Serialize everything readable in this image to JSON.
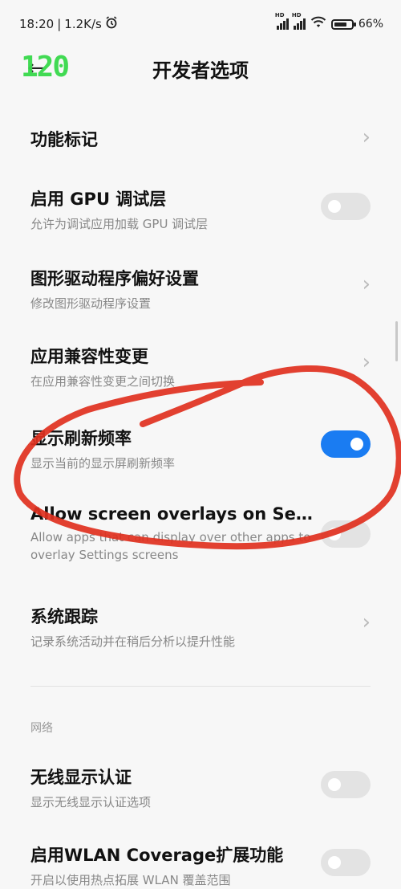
{
  "status": {
    "time": "18:20",
    "speed": "1.2K/s",
    "battery_pct": "66%",
    "hd1": "HD",
    "hd2": "HD"
  },
  "overlay": {
    "fps": "120"
  },
  "header": {
    "back_icon": "←",
    "title": "开发者选项"
  },
  "rows": [
    {
      "title": "功能标记",
      "type": "chevron"
    },
    {
      "title": "启用 GPU 调试层",
      "sub": "允许为调试应用加载 GPU 调试层",
      "type": "toggle",
      "on": false
    },
    {
      "title": "图形驱动程序偏好设置",
      "sub": "修改图形驱动程序设置",
      "type": "chevron"
    },
    {
      "title": "应用兼容性变更",
      "sub": "在应用兼容性变更之间切换",
      "type": "chevron"
    },
    {
      "title": "显示刷新频率",
      "sub": "显示当前的显示屏刷新频率",
      "type": "toggle",
      "on": true
    },
    {
      "title": "Allow screen overlays on Set…",
      "sub": "Allow apps that can display over other apps to overlay Settings screens",
      "type": "toggle",
      "on": false
    },
    {
      "title": "系统跟踪",
      "sub": "记录系统活动并在稍后分析以提升性能",
      "type": "chevron"
    }
  ],
  "network_section": {
    "label": "网络"
  },
  "network_rows": [
    {
      "title": "无线显示认证",
      "sub": "显示无线显示认证选项",
      "type": "toggle",
      "on": false
    },
    {
      "title": "启用WLAN Coverage扩展功能",
      "sub": "开启以使用热点拓展 WLAN 覆盖范围",
      "type": "toggle",
      "on": false
    }
  ],
  "chevron_glyph": "›",
  "colors": {
    "accent": "#1a7cf2",
    "annotation": "#e0301e",
    "fps": "#38d94b"
  }
}
